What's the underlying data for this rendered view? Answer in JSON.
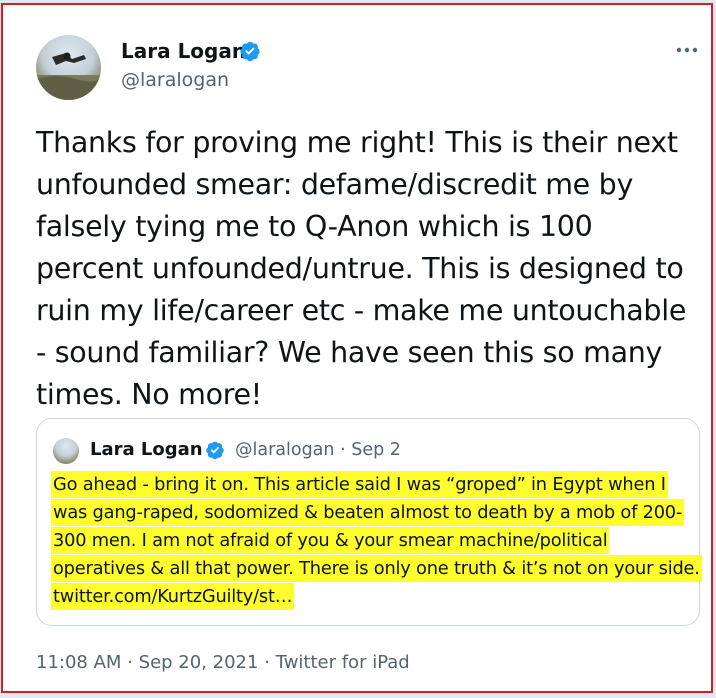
{
  "author": {
    "display_name": "Lara Logan",
    "handle": "@laralogan",
    "verified_icon": "verified-badge-icon",
    "badge_color": "#1d9bf0"
  },
  "more_icon": "more-options-icon",
  "tweet_text": "Thanks for proving me right! This is their next unfounded smear: defame/discredit me by falsely tying me to Q-Anon which is 100 percent unfounded/untrue. This is designed to ruin my life/career etc - make me untouchable - sound familiar? We have seen this so many times. No more!",
  "quoted_tweet": {
    "display_name": "Lara Logan",
    "handle": "@laralogan",
    "separator": "·",
    "date": "Sep 2",
    "text": "Go ahead - bring it on. This article said I was “groped” in Egypt when I was gang-raped, sodomized & beaten almost to death by a mob of 200-300 men. I am not afraid of you & your smear machine/political operatives & all that power. There is only one truth & it’s not on your side. twitter.com/KurtzGuilty/st…",
    "highlight_color": "#fffe2d"
  },
  "footer": {
    "time": "11:08 AM",
    "separator": "·",
    "date": "Sep 20, 2021",
    "source": "Twitter for iPad"
  },
  "colors": {
    "frame_border": "#d0201e",
    "text_primary": "#0f1419",
    "text_secondary": "#536471"
  }
}
